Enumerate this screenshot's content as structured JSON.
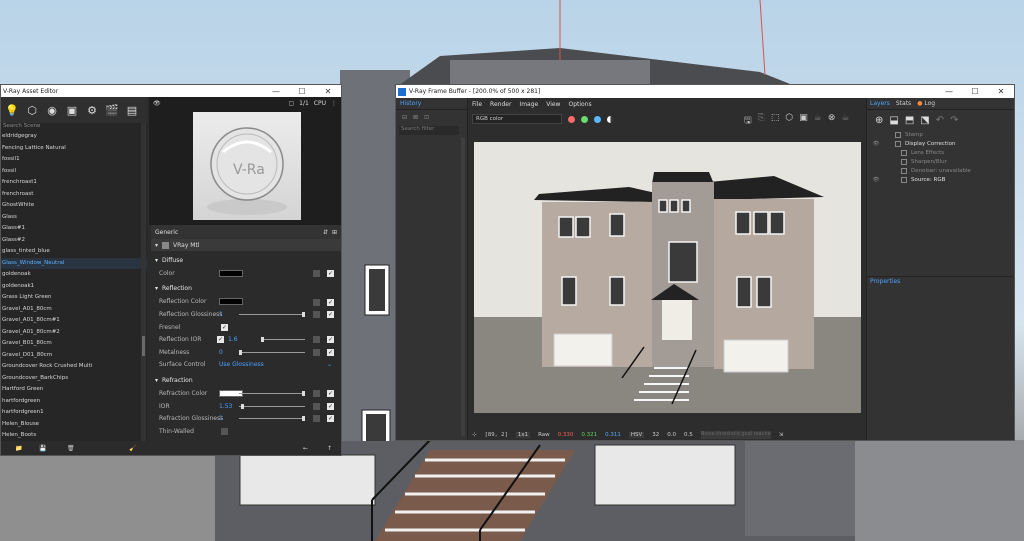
{
  "asset_editor": {
    "title": "V-Ray Asset Editor",
    "search_placeholder": "Search Scene",
    "materials": [
      "eldridgegray",
      "Fencing Lattice Natural",
      "fossil1",
      "fossil",
      "frenchroast1",
      "frenchroast",
      "GhostWhite",
      "Glass",
      "Glass#1",
      "Glass#2",
      "glass_tinted_blue",
      "Glass_Window_Neutral",
      "goldenoak",
      "goldenoak1",
      "Grass Light Green",
      "Gravel_A01_80cm",
      "Gravel_A01_80cm#1",
      "Gravel_A01_80cm#2",
      "Gravel_B01_80cm",
      "Gravel_D01_80cm",
      "Groundcover Rock Crushed Multi",
      "Groundcover_BarkChips",
      "Hartford Green",
      "hartfordgreen",
      "hartfordgreen1",
      "Helen_Blouse",
      "Helen_Boots"
    ],
    "selected_index": 11,
    "preview_label": "CPU",
    "preview_ratio": "1/1",
    "generic_label": "Generic",
    "material_type": "VRay Mtl",
    "diffuse": {
      "section": "Diffuse",
      "color_label": "Color"
    },
    "reflection": {
      "section": "Reflection",
      "color_label": "Reflection Color",
      "glossiness_label": "Reflection Glossiness",
      "glossiness_value": "1",
      "fresnel_label": "Fresnel",
      "ior_label": "Reflection IOR",
      "ior_value": "1.6",
      "metalness_label": "Metalness",
      "metalness_value": "0",
      "surface_label": "Surface Control",
      "surface_value": "Use Glossiness"
    },
    "refraction": {
      "section": "Refraction",
      "color_label": "Refraction Color",
      "ior_label": "IOR",
      "ior_value": "1.53",
      "glossiness_label": "Refraction Glossiness",
      "glossiness_value": "1",
      "thin_label": "Thin-Walled"
    }
  },
  "vfb": {
    "title": "V-Ray Frame Buffer - [200.0% of 500 x 281]",
    "history_tab": "History",
    "history_search": "Search filter",
    "menu": [
      "File",
      "Render",
      "Image",
      "View",
      "Options"
    ],
    "channel": "RGB color",
    "status": {
      "coords": "[89, 2]",
      "zoom": "1x1",
      "raw": "Raw",
      "r": "0.330",
      "g": "0.321",
      "b": "0.311",
      "mode": "HSV",
      "h": "32",
      "s": "0.0",
      "v": "0.5",
      "hint": "Noise threshold goal reached (0.005P...)"
    },
    "layer_tabs": [
      "Layers",
      "Stats",
      "Log"
    ],
    "layers": [
      {
        "name": "Stamp",
        "on": false,
        "indent": 1
      },
      {
        "name": "Display Correction",
        "on": true,
        "indent": 1
      },
      {
        "name": "Lens Effects",
        "on": false,
        "indent": 2
      },
      {
        "name": "Sharpen/Blur",
        "on": false,
        "indent": 2
      },
      {
        "name": "Denoiser: unavailable",
        "on": false,
        "indent": 2
      },
      {
        "name": "Source: RGB",
        "on": true,
        "indent": 2
      }
    ],
    "properties_label": "Properties"
  },
  "colors": {
    "accent": "#4ba3ff",
    "panel": "#2b2b2b",
    "selected": "#5bb3ff"
  }
}
